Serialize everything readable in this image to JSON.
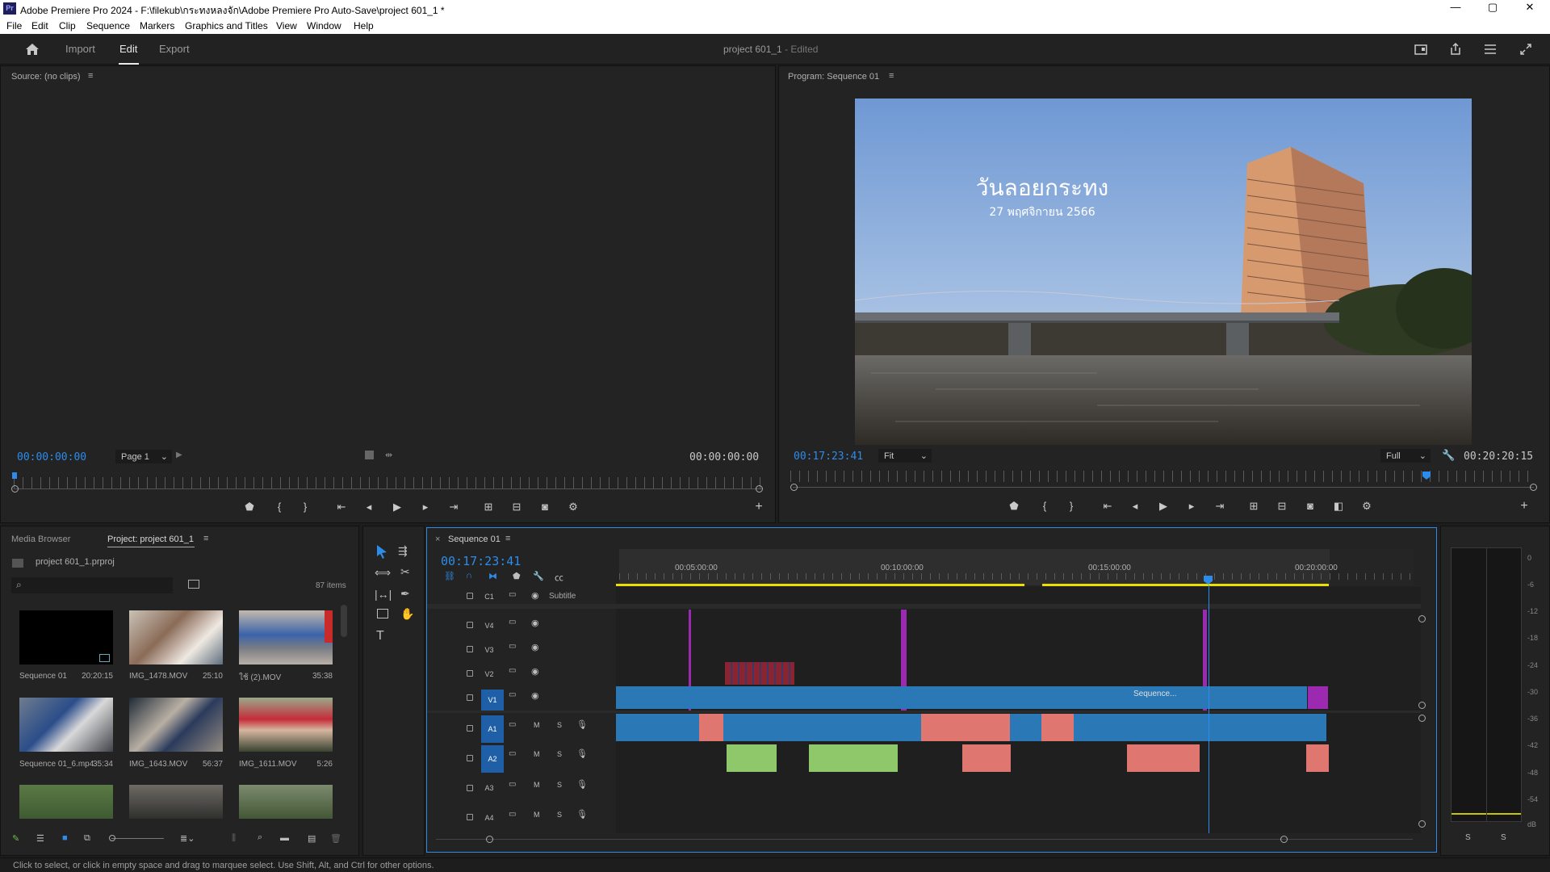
{
  "window": {
    "title": "Adobe Premiere Pro 2024 - F:\\filekub\\กระทงหลงจัก\\Adobe Premiere Pro Auto-Save\\project 601_1 *",
    "app_icon": "Pr",
    "minimize": "—",
    "maximize": "▢",
    "close": "✕"
  },
  "menu": [
    "File",
    "Edit",
    "Clip",
    "Sequence",
    "Markers",
    "Graphics and Titles",
    "View",
    "Window",
    "Help"
  ],
  "appbar": {
    "home_icon": "home-icon",
    "tabs": [
      "Import",
      "Edit",
      "Export"
    ],
    "active_tab": "Edit",
    "project_name": "project 601_1",
    "edited": "- Edited"
  },
  "source": {
    "title": "Source: (no clips)",
    "timecode_in": "00:00:00:00",
    "page": "Page 1",
    "timecode_out": "00:00:00:00"
  },
  "program": {
    "title": "Program: Sequence 01",
    "overlay_title": "วันลอยกระทง",
    "overlay_sub": "27 พฤศจิกายน 2566",
    "timecode": "00:17:23:41",
    "fit": "Fit",
    "quality": "Full",
    "duration": "00:20:20:15"
  },
  "project": {
    "tab_media": "Media Browser",
    "tab_project": "Project: project 601_1",
    "file": "project 601_1.prproj",
    "items": "87 items",
    "clips": [
      {
        "name": "Sequence 01",
        "dur": "20:20:15"
      },
      {
        "name": "IMG_1478.MOV",
        "dur": "25:10"
      },
      {
        "name": "ใช้ (2).MOV",
        "dur": "35:38"
      },
      {
        "name": "Sequence 01_6.mp4",
        "dur": "35:34"
      },
      {
        "name": "IMG_1643.MOV",
        "dur": "56:37"
      },
      {
        "name": "IMG_1611.MOV",
        "dur": "5:26"
      }
    ]
  },
  "sequence": {
    "tab": "Sequence 01",
    "timecode": "00:17:23:41",
    "ruler": [
      "00:05:00:00",
      "00:10:00:00",
      "00:15:00:00",
      "00:20:00:00"
    ],
    "tracks": {
      "c1": "C1",
      "subtitle": "Subtitle",
      "video": [
        "V4",
        "V3",
        "V2",
        "V1"
      ],
      "audio": [
        "A1",
        "A2",
        "A3",
        "A4"
      ],
      "m": "M",
      "s": "S"
    },
    "clip_label": "Sequence..."
  },
  "meter": {
    "labels": [
      "0",
      "-6",
      "-12",
      "-18",
      "-24",
      "-30",
      "-36",
      "-42",
      "-48",
      "-54",
      "dB"
    ],
    "solo": "S"
  },
  "status": "Click to select, or click in empty space and drag to marquee select. Use Shift, Alt, and Ctrl for other options.",
  "colors": {
    "accent": "#2d8ceb",
    "video_clip": "#2a78b5",
    "audio_clip": "#e07670",
    "audio_green": "#8fc86b",
    "adjust": "#9b2ab0"
  }
}
